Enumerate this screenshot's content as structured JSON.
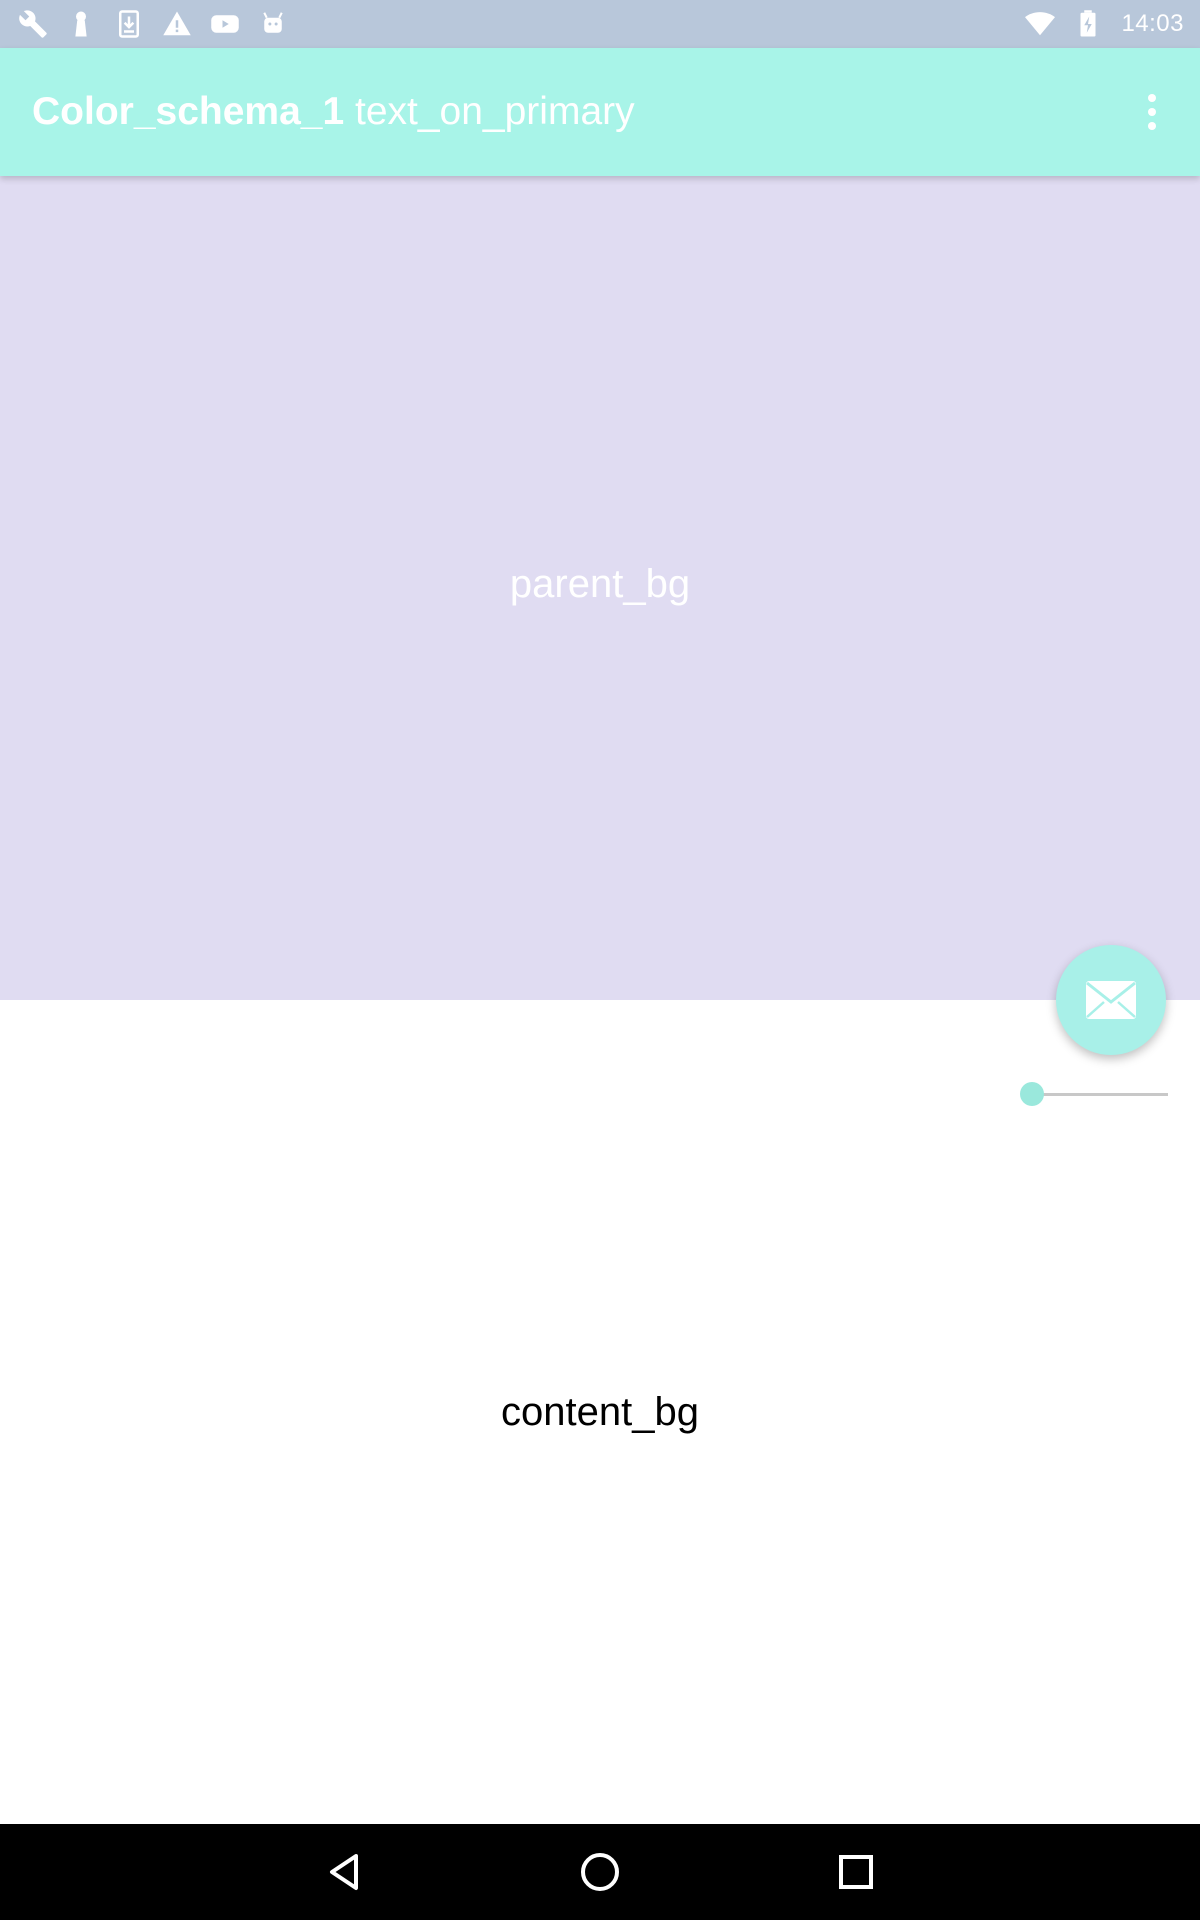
{
  "status_bar": {
    "time": "14:03",
    "left_icons": [
      "wrench-icon",
      "keyhole-icon",
      "download-icon",
      "warning-icon",
      "youtube-icon",
      "android-icon"
    ],
    "right_icons": [
      "wifi-icon",
      "battery-charging-icon"
    ]
  },
  "app_bar": {
    "title_part1": "Color_schema_1",
    "title_part2": "text_on_primary",
    "overflow_icon": "more-vert-icon"
  },
  "parent_panel": {
    "label": "parent_bg"
  },
  "content_panel": {
    "label": "content_bg"
  },
  "fab": {
    "icon": "mail-icon"
  },
  "slider": {
    "value": 0.0
  },
  "nav_bar": {
    "buttons": [
      "back-icon",
      "home-icon",
      "recents-icon"
    ]
  },
  "colors": {
    "status_bar": "#b8c7da",
    "primary": "#a8f4e8",
    "parent_bg": "#e0dcf2",
    "content_bg": "#ffffff",
    "accent": "#a8f0e8",
    "nav_bar": "#000000"
  }
}
